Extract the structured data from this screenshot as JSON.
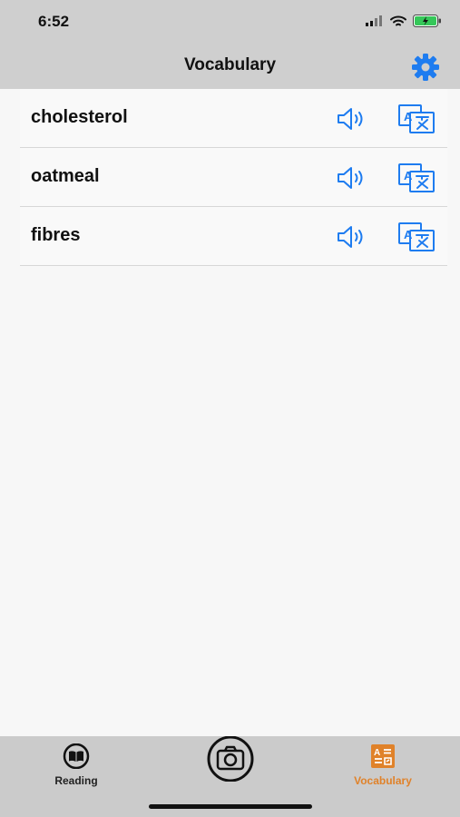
{
  "status_bar": {
    "time": "6:52"
  },
  "nav": {
    "title": "Vocabulary",
    "settings_icon": "gear-icon",
    "accent_color": "#1e7cf0"
  },
  "vocabulary": {
    "words": [
      {
        "word": "cholesterol",
        "speak_icon": "speaker-icon",
        "translate_icon": "translate-icon"
      },
      {
        "word": "oatmeal",
        "speak_icon": "speaker-icon",
        "translate_icon": "translate-icon"
      },
      {
        "word": "fibres",
        "speak_icon": "speaker-icon",
        "translate_icon": "translate-icon"
      }
    ]
  },
  "tabbar": {
    "tabs": [
      {
        "label": "Reading",
        "icon": "book-icon",
        "active": false
      },
      {
        "label": "",
        "icon": "camera-icon",
        "active": false
      },
      {
        "label": "Vocabulary",
        "icon": "flashcard-icon",
        "active": true
      }
    ],
    "active_color": "#e0822a"
  }
}
